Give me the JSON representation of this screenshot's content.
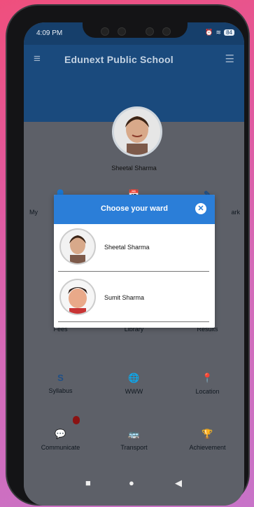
{
  "status": {
    "time": "4:09 PM",
    "battery": "84"
  },
  "appbar": {
    "title": "Edunext Public School"
  },
  "profile": {
    "name": "Sheetal Sharma"
  },
  "grid_items": [
    {
      "label": "Syllabus",
      "icon": "S"
    },
    {
      "label": "WWW",
      "icon": "globe-icon"
    },
    {
      "label": "Location",
      "icon": "location-pin-icon"
    },
    {
      "label": "Communicate",
      "icon": "chat-icon"
    },
    {
      "label": "Transport",
      "icon": "bus-icon"
    },
    {
      "label": "Achievement",
      "icon": "trophy-icon"
    },
    {
      "label": "Fees",
      "icon": "fees-icon"
    },
    {
      "label": "Library",
      "icon": "library-icon"
    },
    {
      "label": "Results",
      "icon": "results-icon"
    }
  ],
  "partial_labels": {
    "left": "My",
    "left2": "C",
    "right": "ark",
    "right2": "ar"
  },
  "modal": {
    "title": "Choose your ward",
    "wards": [
      {
        "name": "Sheetal Sharma"
      },
      {
        "name": "Sumit Sharma"
      }
    ]
  },
  "colors": {
    "appbar": "#1a4a7d",
    "modal_header": "#2b7ed8",
    "badge": "#8b1212"
  }
}
